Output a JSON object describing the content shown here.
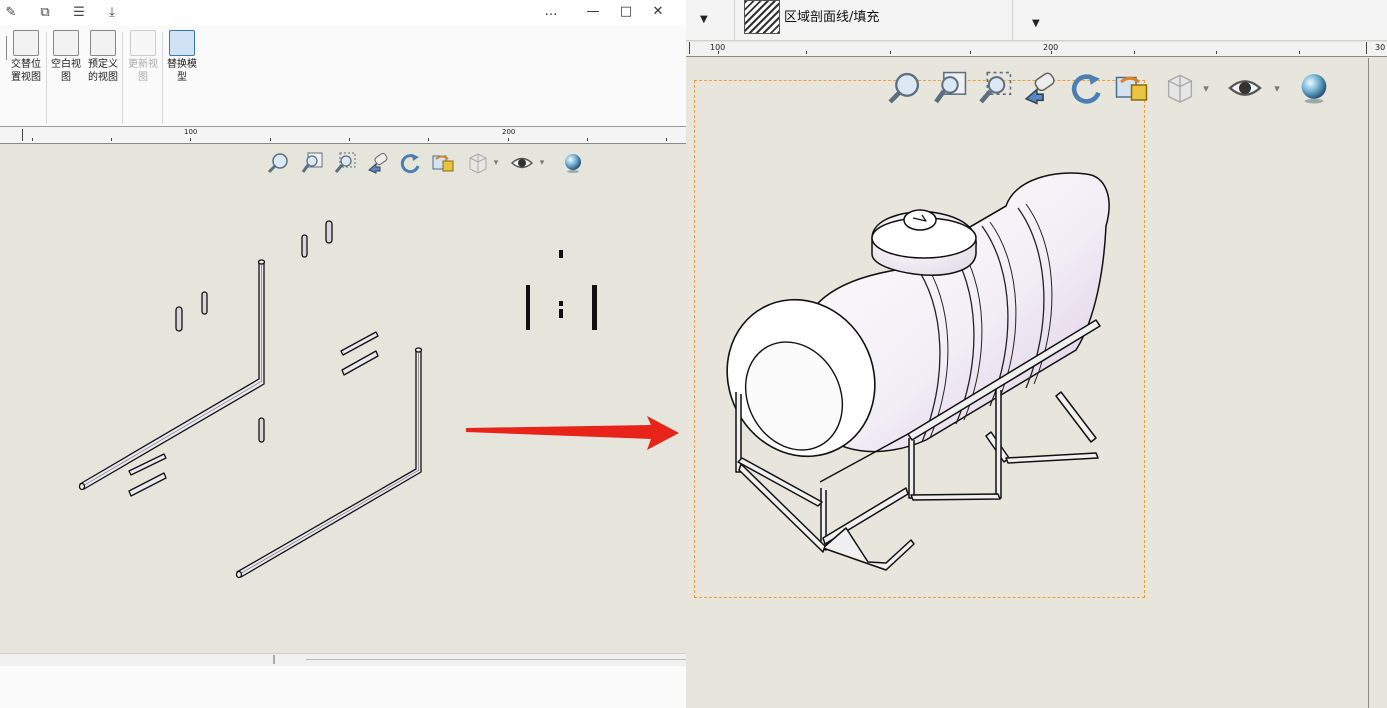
{
  "left_window": {
    "ribbon": {
      "items": [
        {
          "label": "交替位置视图",
          "disabled": false
        },
        {
          "label": "空白视图",
          "disabled": false
        },
        {
          "label": "预定义的视图",
          "disabled": false
        },
        {
          "label": "更新视图",
          "disabled": true
        },
        {
          "label": "替换模型",
          "disabled": false
        }
      ]
    },
    "ruler": {
      "labels": [
        "100",
        "200"
      ]
    },
    "view_toolbar": {
      "icons": [
        "zoom-to-fit-icon",
        "zoom-to-area-icon",
        "zoom-in-out-icon",
        "pan-icon",
        "rotate-icon",
        "apply-scene-icon",
        "view-orientation-icon",
        "hide-show-icon",
        "appearance-sphere-icon"
      ]
    }
  },
  "right_window": {
    "top_toolbar": {
      "hatch_label": "区域剖面线/填充"
    },
    "ruler": {
      "labels": [
        "100",
        "200",
        "30"
      ]
    },
    "view_toolbar": {
      "icons": [
        "zoom-to-fit-icon",
        "zoom-to-area-icon",
        "zoom-in-out-icon",
        "pan-icon",
        "rotate-icon",
        "apply-scene-icon",
        "view-orientation-icon",
        "hide-show-icon",
        "appearance-sphere-icon"
      ]
    }
  },
  "colors": {
    "canvas": "#e5e5dc",
    "arrow": "#e8231a",
    "selection": "#f0a030"
  }
}
